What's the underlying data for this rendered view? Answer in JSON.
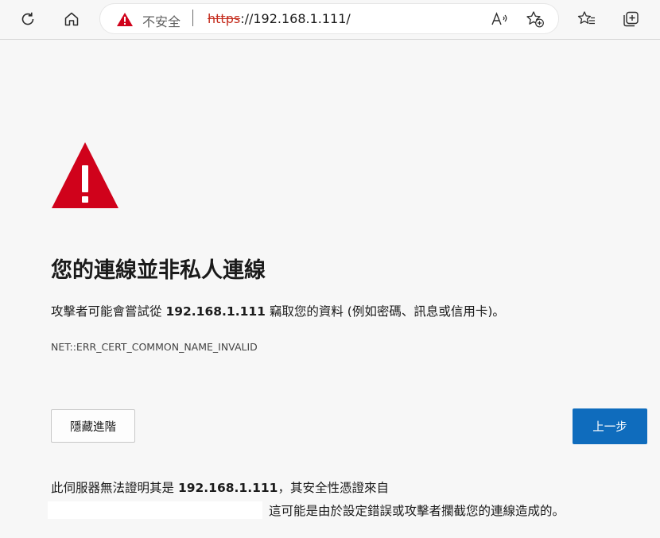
{
  "toolbar": {
    "security_label": "不安全",
    "url_scheme": "https",
    "url_rest": "://192.168.1.111/",
    "icons": [
      "refresh-icon",
      "home-icon",
      "read-aloud-icon",
      "add-favorite-icon",
      "favorites-icon",
      "collections-icon"
    ]
  },
  "page": {
    "headline": "您的連線並非私人連線",
    "desc_pre": "攻擊者可能會嘗試從 ",
    "desc_host": "192.168.1.111",
    "desc_post": " 竊取您的資料 (例如密碼、訊息或信用卡)。",
    "error_code": "NET::ERR_CERT_COMMON_NAME_INVALID",
    "advanced_button": "隱藏進階",
    "back_button": "上一步",
    "detail_pre": "此伺服器無法證明其是 ",
    "detail_host": "192.168.1.111",
    "detail_post": "，其安全性憑證來自",
    "detail_line2": "這可能是由於設定錯誤或攻擊者攔截您的連線造成的。"
  },
  "colors": {
    "warning_red": "#d0021b",
    "url_scheme_red": "#c42b1c",
    "primary_blue": "#0f6cbd"
  }
}
